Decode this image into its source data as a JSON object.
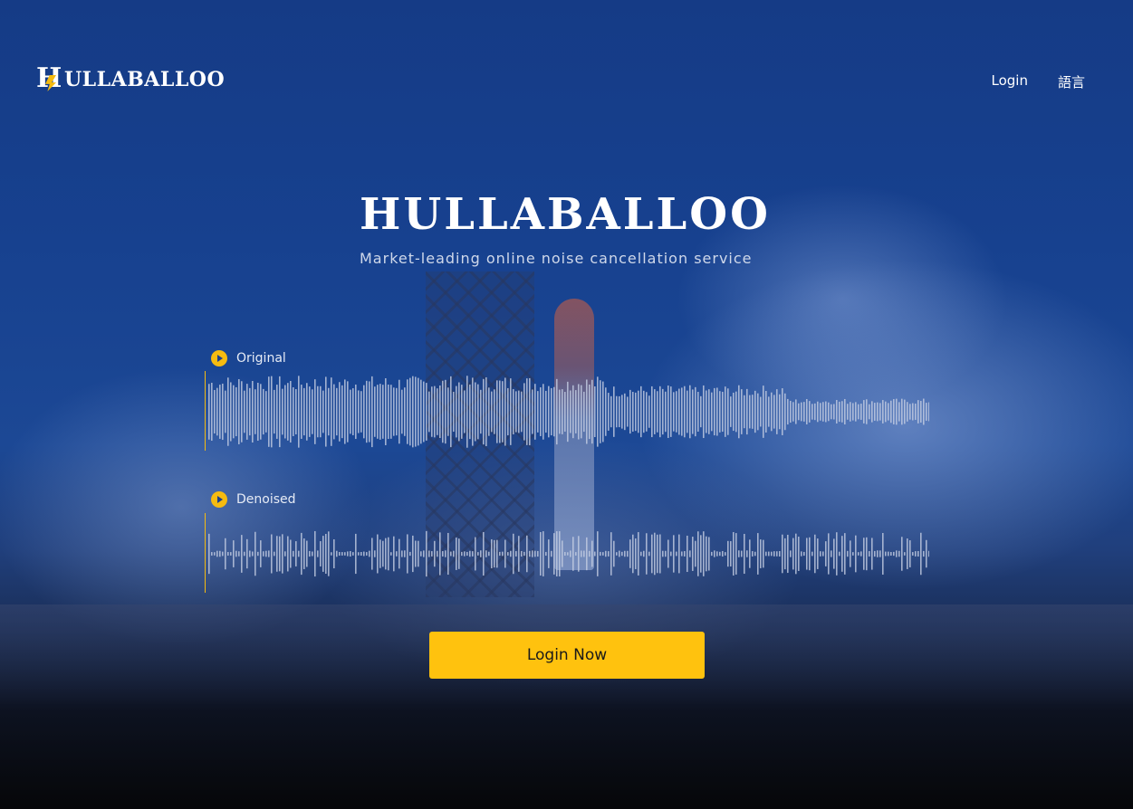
{
  "header": {
    "brand_name": "ULLABALLOO",
    "brand_letter": "H",
    "nav": [
      {
        "label": "Login"
      },
      {
        "label": "語言"
      }
    ]
  },
  "hero": {
    "title": "HULLABALLOO",
    "subtitle": "Market-leading online noise cancellation service"
  },
  "tracks": [
    {
      "label": "Original",
      "icon": "play-icon"
    },
    {
      "label": "Denoised",
      "icon": "play-icon"
    }
  ],
  "cta": {
    "label": "Login Now"
  },
  "colors": {
    "accent": "#ffc20e",
    "background_blue": "#17418f",
    "waveform": "#c4cde2"
  }
}
